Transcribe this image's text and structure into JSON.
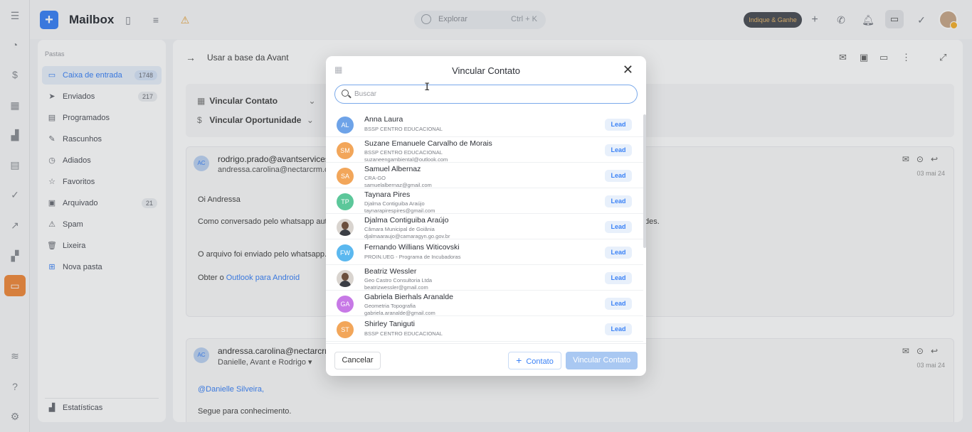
{
  "app": {
    "title": "Mailbox"
  },
  "topbar": {
    "search_placeholder": "Explorar",
    "search_shortcut": "Ctrl + K",
    "refer_label": "Indique & Ganhe"
  },
  "rail_icons": [
    "menu-icon",
    "dashboard-icon",
    "dollar-icon",
    "building-icon",
    "chart-icon",
    "calendar-icon",
    "check-circle-icon",
    "trend-icon",
    "widgets-icon",
    "inbox-icon",
    "layers-icon",
    "help-icon",
    "settings-icon"
  ],
  "folders": {
    "header": "Pastas",
    "items": [
      {
        "label": "Caixa de entrada",
        "count": "1748",
        "icon": "inbox-icon",
        "active": true
      },
      {
        "label": "Enviados",
        "count": "217",
        "icon": "send-icon"
      },
      {
        "label": "Programados",
        "count": "",
        "icon": "calendar-icon"
      },
      {
        "label": "Rascunhos",
        "count": "",
        "icon": "pencil-icon"
      },
      {
        "label": "Adiados",
        "count": "",
        "icon": "clock-icon"
      },
      {
        "label": "Favoritos",
        "count": "",
        "icon": "star-icon"
      },
      {
        "label": "Arquivado",
        "count": "21",
        "icon": "archive-icon"
      },
      {
        "label": "Spam",
        "count": "",
        "icon": "warning-icon"
      },
      {
        "label": "Lixeira",
        "count": "",
        "icon": "trash-icon"
      },
      {
        "label": "Nova pasta",
        "count": "",
        "icon": "folder-plus-icon"
      }
    ],
    "footer": "Estatísticas"
  },
  "main": {
    "title": "Usar a base da Avant",
    "link_contact": "Vincular Contato",
    "link_opportunity": "Vincular Oportunidade",
    "mail1": {
      "avatar": "AC",
      "from": "rodrigo.prado@avantservices",
      "to": "andressa.carolina@nectarcrm.com",
      "date": "03 mai 24",
      "greeting": "Oi Andressa",
      "line1": "Como conversado pelo whatsapp auto",
      "line1_tail": "des.",
      "line2": "O arquivo foi enviado pelo whatsapp.",
      "line3_prefix": "Obter o ",
      "line3_link": "Outlook para Android"
    },
    "mail2": {
      "avatar": "AC",
      "from": "andressa.carolina@nectarcrm",
      "to": "Danielle, Avant e Rodrigo",
      "date": "03 mai 24",
      "mention": "@Danielle Silveira,",
      "line1": "Segue para conhecimento."
    }
  },
  "modal": {
    "title": "Vincular Contato",
    "search_placeholder": "Buscar",
    "contacts": [
      {
        "initials": "AL",
        "color": "#6ea3e8",
        "name": "Anna Laura",
        "company": "BSSP CENTRO EDUCACIONAL",
        "email": "",
        "tag": "Lead"
      },
      {
        "initials": "SM",
        "color": "#f2a65a",
        "name": "Suzane Emanuele Carvalho de Morais",
        "company": "BSSP CENTRO EDUCACIONAL",
        "email": "suzaneengambiental@outlook.com",
        "tag": "Lead"
      },
      {
        "initials": "SA",
        "color": "#f2a65a",
        "name": "Samuel Albernaz",
        "company": "CRA-GO",
        "email": "samuelalbernaz@gmail.com",
        "tag": "Lead"
      },
      {
        "initials": "TP",
        "color": "#5cc79a",
        "name": "Taynara Pires",
        "company": "Djalma Contiguiba Araújo",
        "email": "taynarapirespires@gmail.com",
        "tag": "Lead"
      },
      {
        "initials": "",
        "color": "",
        "photo": true,
        "name": "Djalma Contiguiba Araújo",
        "company": "Câmara Municipal de Goiânia",
        "email": "djalmaaraujo@camaragyn.go.gov.br",
        "tag": "Lead"
      },
      {
        "initials": "FW",
        "color": "#5bb8ef",
        "name": "Fernando Willians Witicovski",
        "company": "PROIN.UEG - Programa de Incubadoras",
        "email": "",
        "tag": "Lead"
      },
      {
        "initials": "",
        "color": "",
        "photo": true,
        "name": "Beatriz Wessler",
        "company": "Geo Castro Consultoria Ltda",
        "email": "beatrizwessler@gmail.com",
        "tag": "Lead"
      },
      {
        "initials": "GA",
        "color": "#c779e6",
        "name": "Gabriela Bierhals Aranalde",
        "company": "Geometria Topografia",
        "email": "gabriela.aranalde@gmail.com",
        "tag": "Lead"
      },
      {
        "initials": "ST",
        "color": "#f2a65a",
        "name": "Shirley Taniguti",
        "company": "BSSP CENTRO EDUCACIONAL",
        "email": "",
        "tag": "Lead"
      }
    ],
    "cancel_label": "Cancelar",
    "contact_label": "Contato",
    "link_label": "Vincular Contato"
  }
}
